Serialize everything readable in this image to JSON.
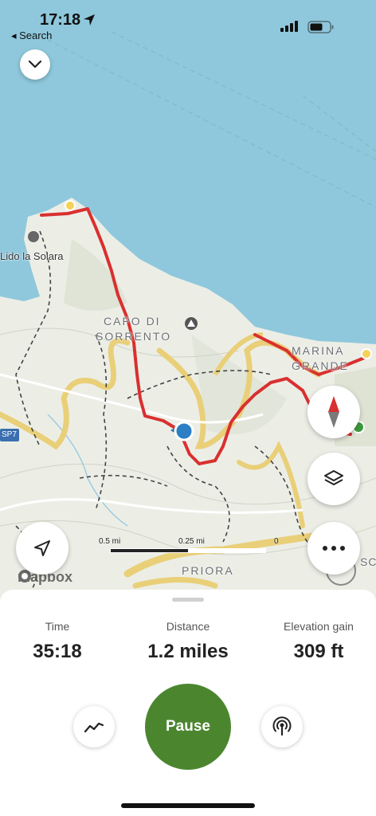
{
  "status_bar": {
    "time": "17:18",
    "back_label": "◂ Search"
  },
  "map": {
    "labels": {
      "lido": "Lido la Solara",
      "capo_line1": "CAPO DI",
      "capo_line2": "SORRENTO",
      "marina_line1": "MARINA",
      "marina_line2": "GRANDE",
      "priora": "PRIORA",
      "sp7": "SP7",
      "edge_fragment": "SCH"
    },
    "scale": {
      "left": "0.5 mi",
      "middle": "0.25 mi",
      "right": "0"
    },
    "attribution": "mapbox",
    "colors": {
      "sea": "#8fc8dc",
      "land": "#eceee6",
      "track": "#d93030",
      "road": "#f0d57a"
    }
  },
  "controls": {
    "collapse_icon": "chevron-down-icon",
    "compass_icon": "compass-icon",
    "layers_icon": "layers-icon",
    "more_icon": "ellipsis-icon",
    "locate_icon": "location-arrow-icon"
  },
  "stats": {
    "time": {
      "label": "Time",
      "value": "35:18"
    },
    "distance": {
      "label": "Distance",
      "value": "1.2 miles"
    },
    "elevation": {
      "label": "Elevation gain",
      "value": "309 ft"
    }
  },
  "actions": {
    "pause_label": "Pause",
    "pause_color": "#4b862f",
    "chart_icon": "trend-line-icon",
    "broadcast_icon": "broadcast-icon"
  }
}
